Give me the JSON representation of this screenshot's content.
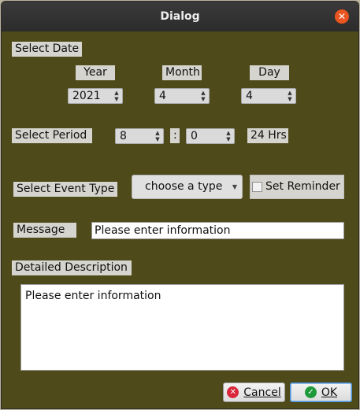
{
  "window": {
    "title": "Dialog"
  },
  "date": {
    "section_label": "Select Date",
    "year_label": "Year",
    "month_label": "Month",
    "day_label": "Day",
    "year_value": "2021",
    "month_value": "4",
    "day_value": "4"
  },
  "period": {
    "label": "Select Period",
    "hour_value": "8",
    "separator": ":",
    "minute_value": "0",
    "unit": "24 Hrs"
  },
  "event": {
    "label": "Select Event Type",
    "combo_value": "choose a type",
    "reminder_label": "Set Reminder",
    "reminder_checked": false
  },
  "message": {
    "label": "Message",
    "value": "Please enter information"
  },
  "description": {
    "label": "Detailed Description",
    "value": "Please enter information"
  },
  "buttons": {
    "cancel_label": "Cancel",
    "ok_label": "OK"
  },
  "colors": {
    "dialog_bg": "#4e4a1a",
    "titlebar": "#2c2c2c",
    "close_button": "#e95420",
    "cancel_icon": "#d9263b",
    "ok_icon": "#1f9a3a"
  }
}
